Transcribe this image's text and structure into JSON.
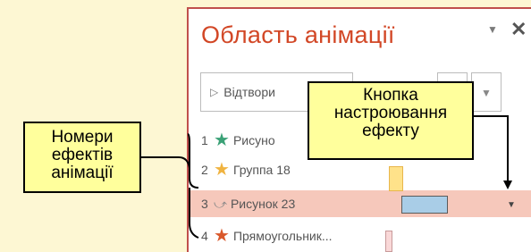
{
  "pane": {
    "title": "Область анімації",
    "play_label": "Відтвори",
    "items": [
      {
        "num": "1",
        "icon": "green-star-icon",
        "color": "#3aa176",
        "label": "Рисуно"
      },
      {
        "num": "2",
        "icon": "yellow-star-icon",
        "color": "#f0b340",
        "label": "Группа 18"
      },
      {
        "num": "3",
        "icon": "motion-path-icon",
        "color": "#888888",
        "label": "Рисунок 23"
      },
      {
        "num": "4",
        "icon": "red-star-icon",
        "color": "#d9582b",
        "label": "Прямоугольник..."
      }
    ]
  },
  "callouts": {
    "effects_label": "Номери ефектів анімації",
    "button_label": "Кнопка настроювання ефекту"
  },
  "colors": {
    "background": "#fdf7d3",
    "accent": "#d24726",
    "selected_row": "#f6c8bb",
    "callout": "#ffff9c"
  }
}
